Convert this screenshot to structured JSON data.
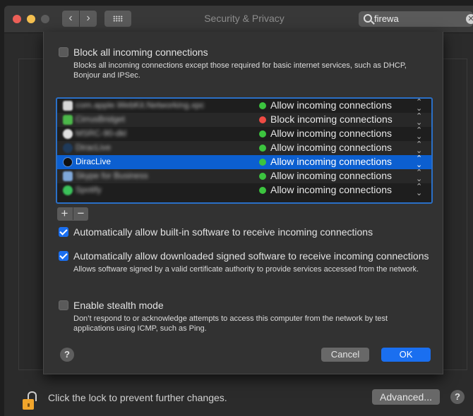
{
  "window": {
    "title": "Security & Privacy",
    "back_glyph": "‹",
    "forward_glyph": "›"
  },
  "search": {
    "value": "firewa",
    "clear_glyph": "✕"
  },
  "block_all": {
    "label": "Block all incoming connections",
    "checked": false,
    "description": "Blocks all incoming connections except those required for basic internet services, such as DHCP, Bonjour and IPSec."
  },
  "apps": [
    {
      "name": "com.apple.WebKit.Networking.xpc",
      "status": "Allow incoming connections",
      "status_color": "#3cc43f",
      "blurred": true
    },
    {
      "name": "CirrusBridget",
      "status": "Block incoming connections",
      "status_color": "#ef4b44",
      "blurred": true
    },
    {
      "name": "MSRC-90-dkl",
      "status": "Allow incoming connections",
      "status_color": "#3cc43f",
      "blurred": true
    },
    {
      "name": "DiracLive",
      "status": "Allow incoming connections",
      "status_color": "#3cc43f",
      "blurred": true
    },
    {
      "name": "DiracLive",
      "status": "Allow incoming connections",
      "status_color": "#3cc43f",
      "blurred": false,
      "selected": true
    },
    {
      "name": "Skype for Business",
      "status": "Allow incoming connections",
      "status_color": "#3cc43f",
      "blurred": true
    },
    {
      "name": "Spotify",
      "status": "Allow incoming connections",
      "status_color": "#3cc43f",
      "blurred": true
    }
  ],
  "buttons": {
    "add": "+",
    "remove": "−",
    "cancel": "Cancel",
    "ok": "OK",
    "advanced": "Advanced...",
    "help": "?"
  },
  "auto_builtin": {
    "label": "Automatically allow built-in software to receive incoming connections",
    "checked": true
  },
  "auto_signed": {
    "label": "Automatically allow downloaded signed software to receive incoming connections",
    "checked": true,
    "description": "Allows software signed by a valid certificate authority to provide services accessed from the network."
  },
  "stealth": {
    "label": "Enable stealth mode",
    "checked": false,
    "description": "Don’t respond to or acknowledge attempts to access this computer from the network by test applications using ICMP, such as Ping."
  },
  "footer": {
    "lock_text": "Click the lock to prevent further changes."
  },
  "colors": {
    "accent": "#1a6ff0",
    "allow": "#3cc43f",
    "block": "#ef4b44",
    "selection": "#0c5fd0"
  }
}
